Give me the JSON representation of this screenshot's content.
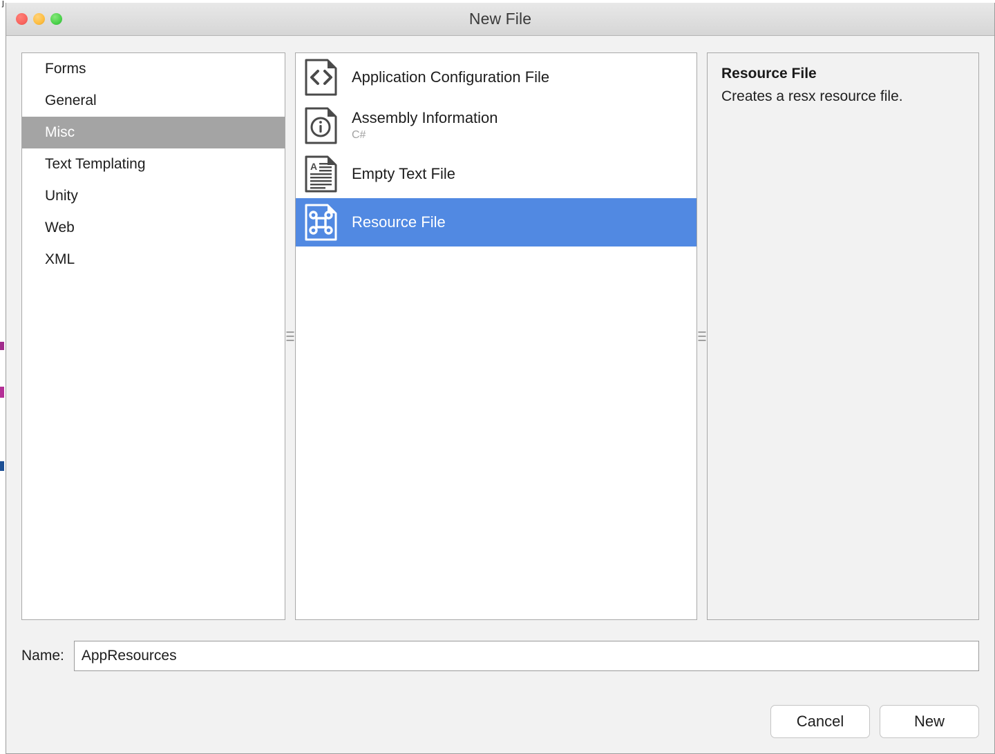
{
  "window": {
    "title": "New File",
    "traffic_lights": [
      "close",
      "minimize",
      "zoom"
    ]
  },
  "background_window": {
    "fragment_text": "j"
  },
  "categories": {
    "items": [
      {
        "label": "Forms",
        "selected": false
      },
      {
        "label": "General",
        "selected": false
      },
      {
        "label": "Misc",
        "selected": true
      },
      {
        "label": "Text Templating",
        "selected": false
      },
      {
        "label": "Unity",
        "selected": false
      },
      {
        "label": "Web",
        "selected": false
      },
      {
        "label": "XML",
        "selected": false
      }
    ]
  },
  "templates": {
    "items": [
      {
        "title": "Application Configuration File",
        "subtitle": "",
        "icon": "code-file-icon",
        "selected": false
      },
      {
        "title": "Assembly Information",
        "subtitle": "C#",
        "icon": "info-file-icon",
        "selected": false
      },
      {
        "title": "Empty Text File",
        "subtitle": "",
        "icon": "text-file-icon",
        "selected": false
      },
      {
        "title": "Resource File",
        "subtitle": "",
        "icon": "command-file-icon",
        "selected": true
      }
    ]
  },
  "description": {
    "title": "Resource File",
    "body": "Creates a resx resource file."
  },
  "name_field": {
    "label": "Name:",
    "value": "AppResources",
    "placeholder": ""
  },
  "footer": {
    "cancel_label": "Cancel",
    "new_label": "New"
  },
  "colors": {
    "selection_blue": "#5189e2",
    "category_selection_gray": "#a4a4a4",
    "dialog_background": "#f2f2f2",
    "panel_border": "#a8a8a8",
    "subtitle_gray": "#a2a2a2"
  }
}
